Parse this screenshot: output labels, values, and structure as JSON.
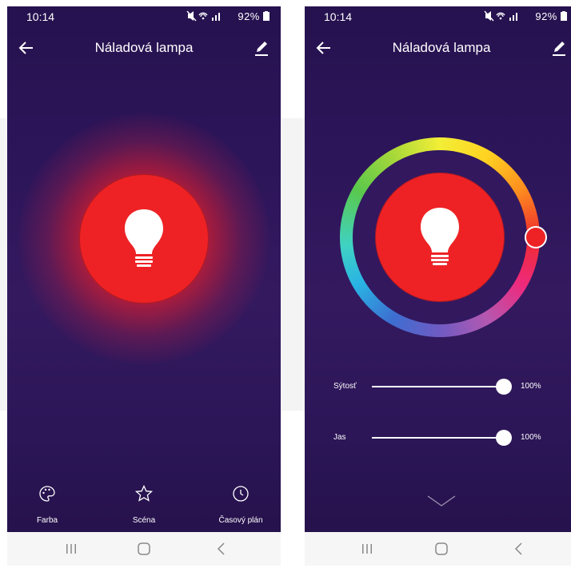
{
  "left_screen": {
    "status": {
      "time": "10:14",
      "icons_text": "🔇 ⚲ ⦙ .ıl 92%▮",
      "battery": "92%"
    },
    "header": {
      "title": "Náladová lampa"
    },
    "tabs": [
      {
        "label": "Farba",
        "icon": "palette-icon"
      },
      {
        "label": "Scéna",
        "icon": "star-icon"
      },
      {
        "label": "Časový plán",
        "icon": "clock-icon"
      }
    ]
  },
  "right_screen": {
    "status": {
      "time": "10:14",
      "icons_text": "🔇 ⚲ ⦙ .ıl 92%▮",
      "battery": "92%"
    },
    "header": {
      "title": "Náladová lampa"
    },
    "sliders": [
      {
        "label": "Sýtosť",
        "value": "100%",
        "level": 1.0
      },
      {
        "label": "Jas",
        "value": "100%",
        "level": 1.0
      }
    ]
  },
  "colors": {
    "background": "#2d155a",
    "lamp": "#ee2225",
    "text": "#ffffff",
    "navbar": "#f6f6f6"
  }
}
